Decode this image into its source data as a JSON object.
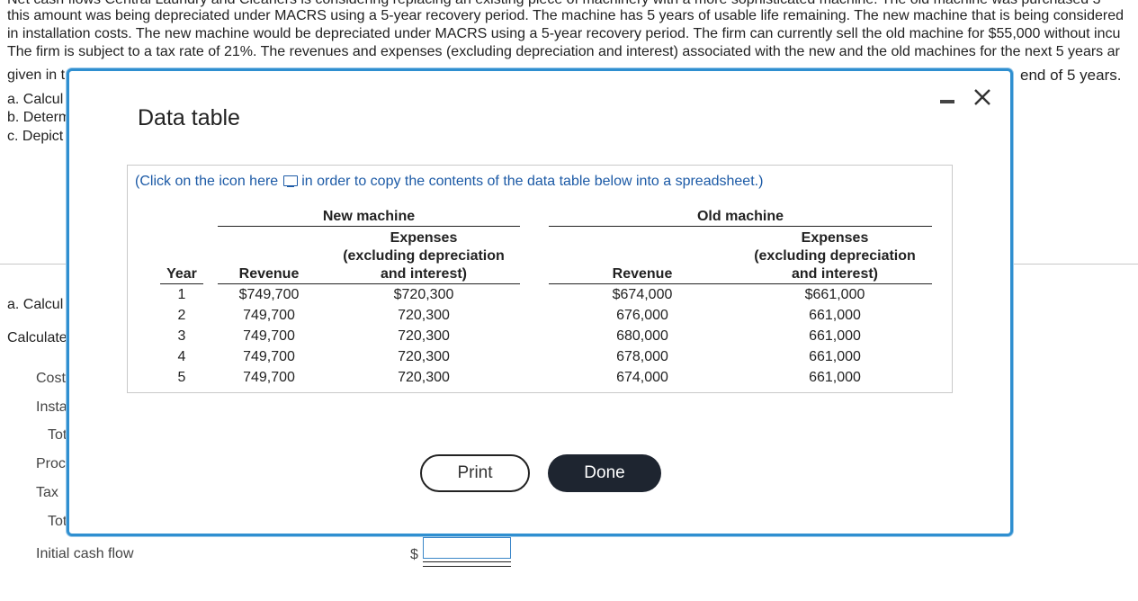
{
  "problem": {
    "line0": "Net cash flows   Central Laundry and Cleaners is considering replacing an existing piece of machinery with a more sophisticated machine. The old machine was purchased 3",
    "line1": "this amount was being depreciated under MACRS using a 5-year recovery period. The machine has 5 years of usable life remaining. The new machine that is being considered",
    "line2": "in installation costs. The new machine would be depreciated under MACRS using a 5-year recovery period. The firm can currently sell the old machine for $55,000 without incu",
    "line3": "The firm is subject to a tax rate of 21%. The revenues and expenses (excluding depreciation and interest) associated with the new and the old machines for the next 5 years ar",
    "line4_left": "given in t",
    "line4_right": "end of 5 years.",
    "item_a": "a. Calcul",
    "item_b": "b. Determ",
    "item_c": "c. Depict",
    "section_a": "a. Calcul",
    "calculate": "Calculate",
    "row_cost": "Cost",
    "row_install": "Insta",
    "row_total1": "Tot",
    "row_proceeds": "Proc",
    "row_tax": "Tax",
    "row_total2": "Tot",
    "initial_cash_flow": "Initial cash flow",
    "dollar": "$"
  },
  "modal": {
    "title": "Data table",
    "copy_before": "(Click on the icon here",
    "copy_after": "in order to copy the contents of the data table below into a spreadsheet.)",
    "print_label": "Print",
    "done_label": "Done"
  },
  "table": {
    "group_new": "New machine",
    "group_old": "Old machine",
    "col_year": "Year",
    "col_revenue": "Revenue",
    "col_expenses_l1": "Expenses",
    "col_expenses_l2": "(excluding depreciation",
    "col_expenses_l3": "and interest)",
    "rows": [
      {
        "year": "1",
        "new_rev": "$749,700",
        "new_exp": "$720,300",
        "old_rev": "$674,000",
        "old_exp": "$661,000"
      },
      {
        "year": "2",
        "new_rev": "749,700",
        "new_exp": "720,300",
        "old_rev": "676,000",
        "old_exp": "661,000"
      },
      {
        "year": "3",
        "new_rev": "749,700",
        "new_exp": "720,300",
        "old_rev": "680,000",
        "old_exp": "661,000"
      },
      {
        "year": "4",
        "new_rev": "749,700",
        "new_exp": "720,300",
        "old_rev": "678,000",
        "old_exp": "661,000"
      },
      {
        "year": "5",
        "new_rev": "749,700",
        "new_exp": "720,300",
        "old_rev": "674,000",
        "old_exp": "661,000"
      }
    ]
  }
}
